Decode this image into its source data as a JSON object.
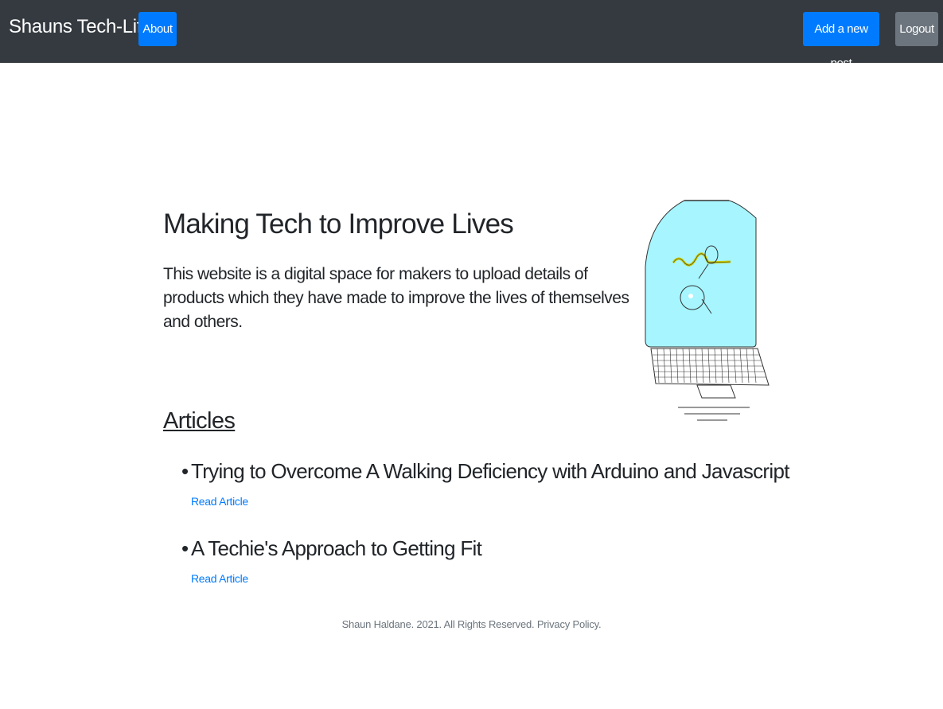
{
  "navbar": {
    "brand": "Shauns Tech-Life",
    "about_label": "About",
    "add_post_label": "Add a new post",
    "logout_label": "Logout"
  },
  "hero": {
    "title": "Making Tech to Improve Lives",
    "text": "This website is a digital space for makers to upload details of products which they have made to improve the lives of themselves and others."
  },
  "articles": {
    "heading": "Articles",
    "items": [
      {
        "title": "Trying to Overcome A Walking Deficiency with Arduino and Javascript",
        "link_label": "Read Article"
      },
      {
        "title": "A Techie's Approach to Getting Fit",
        "link_label": "Read Article"
      }
    ]
  },
  "footer": {
    "text": "Shaun Haldane. 2021. All Rights Reserved. Privacy Policy."
  },
  "colors": {
    "navbar_bg": "#343a40",
    "primary": "#007bff",
    "secondary": "#6c757d",
    "screen_fill": "#a6f5ff"
  }
}
